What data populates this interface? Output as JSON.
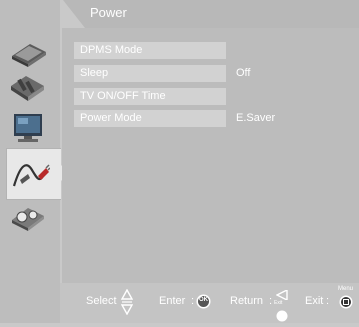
{
  "menu": {
    "title": "Power",
    "items": [
      {
        "label": "DPMS Mode",
        "value": ""
      },
      {
        "label": "Sleep",
        "value": "Off"
      },
      {
        "label": "TV ON/OFF Time",
        "value": ""
      },
      {
        "label": "Power Mode",
        "value": "E.Saver"
      }
    ]
  },
  "sidebar": {
    "icons": [
      "picture-icon",
      "sound-icon",
      "tv-icon",
      "power-plug-icon",
      "setup-icon"
    ],
    "active_icon": "power-plug-icon"
  },
  "footer": {
    "select_label": "Select",
    "enter_label": "Enter",
    "ok_badge": "OK",
    "return_label": "Return",
    "exit_small": "Exit",
    "exit_label": "Exit",
    "menu_small": "Menu"
  }
}
